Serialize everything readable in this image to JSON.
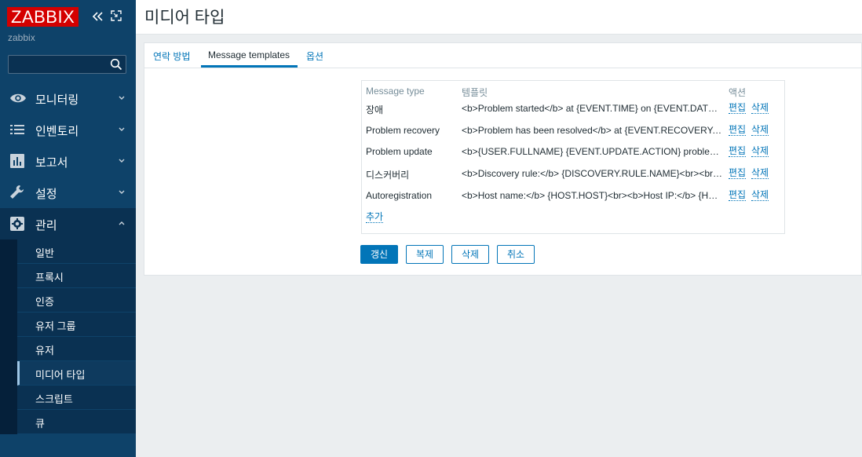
{
  "app": {
    "logo": "ZABBIX",
    "server_name": "zabbix",
    "search": {
      "value": "",
      "placeholder": ""
    }
  },
  "sidebar": {
    "menu": [
      {
        "label": "모니터링",
        "icon": "eye-icon"
      },
      {
        "label": "인벤토리",
        "icon": "list-icon"
      },
      {
        "label": "보고서",
        "icon": "bar-chart-icon"
      },
      {
        "label": "설정",
        "icon": "wrench-icon"
      },
      {
        "label": "관리",
        "icon": "gear-icon"
      }
    ],
    "submenu": [
      {
        "label": "일반"
      },
      {
        "label": "프록시"
      },
      {
        "label": "인증"
      },
      {
        "label": "유저 그룹"
      },
      {
        "label": "유저"
      },
      {
        "label": "미디어 타입"
      },
      {
        "label": "스크립트"
      },
      {
        "label": "큐"
      }
    ]
  },
  "page": {
    "title": "미디어 타입"
  },
  "tabs": [
    {
      "label": "연락 방법"
    },
    {
      "label": "Message templates"
    },
    {
      "label": "옵션"
    }
  ],
  "templates": {
    "headers": {
      "type": "Message type",
      "template": "템플릿",
      "action": "액션"
    },
    "rows": [
      {
        "type": "장애",
        "template": "<b>Problem started</b> at {EVENT.TIME} on {EVENT.DATE}<br><b>Problem name:</b> {EVENT.NAME}",
        "edit": "편집",
        "delete": "삭제"
      },
      {
        "type": "Problem recovery",
        "template": "<b>Problem has been resolved</b> at {EVENT.RECOVERY.TIME} on {EVENT.RECOVERY.DATE}",
        "edit": "편집",
        "delete": "삭제"
      },
      {
        "type": "Problem update",
        "template": "<b>{USER.FULLNAME} {EVENT.UPDATE.ACTION} problem</b> at {EVENT.UPDATE.DATE}",
        "edit": "편집",
        "delete": "삭제"
      },
      {
        "type": "디스커버리",
        "template": "<b>Discovery rule:</b> {DISCOVERY.RULE.NAME}<br><br><b>Device IP:</b>",
        "edit": "편집",
        "delete": "삭제"
      },
      {
        "type": "Autoregistration",
        "template": "<b>Host name:</b> {HOST.HOST}<br><b>Host IP:</b> {HOST.IP}",
        "edit": "편집",
        "delete": "삭제"
      }
    ],
    "add_label": "추가"
  },
  "buttons": {
    "update": "갱신",
    "clone": "복제",
    "delete": "삭제",
    "cancel": "취소"
  },
  "colors": {
    "sidebar": "#0e4269",
    "accent": "#0275b8",
    "logo": "#d40000"
  }
}
